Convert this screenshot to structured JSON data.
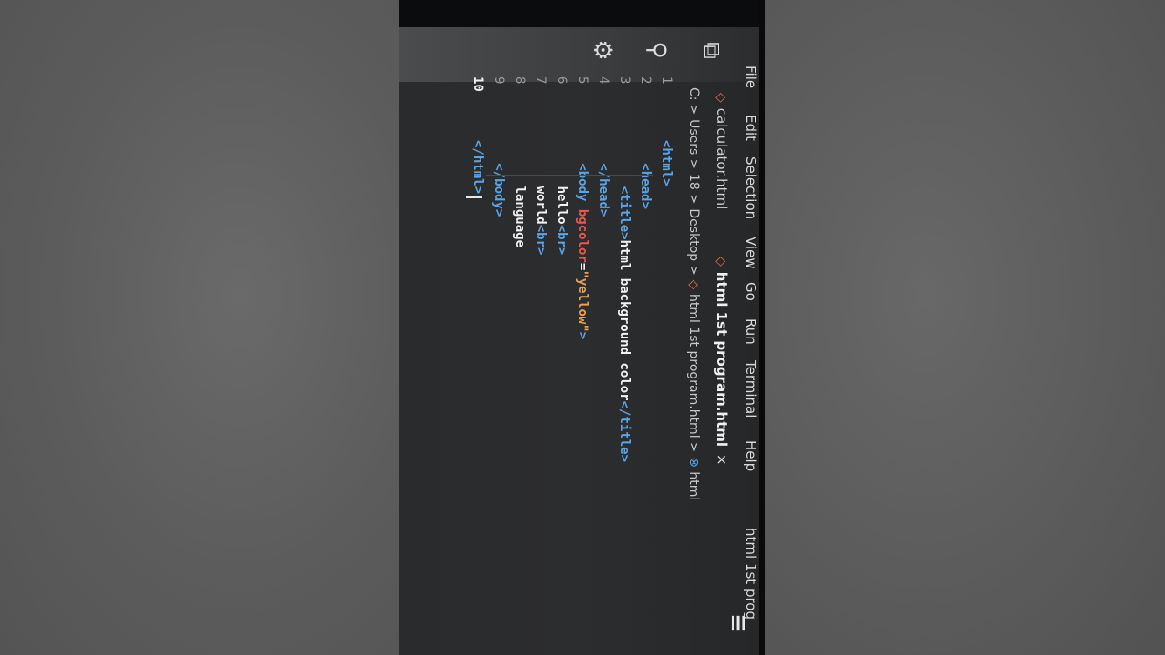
{
  "menu": [
    "File",
    "Edit",
    "Selection",
    "View",
    "Go",
    "Run",
    "Terminal",
    "Help"
  ],
  "window_title": "html 1st prog",
  "tabs": [
    {
      "label": "calculator.html",
      "active": false
    },
    {
      "label": "html 1st program.html",
      "active": true
    }
  ],
  "tab_close": "×",
  "breadcrumb": "C: > Users > 18 > Desktop > ",
  "breadcrumb_file": "html 1st program.html > ",
  "breadcrumb_symbol": "html",
  "line_numbers": [
    "1",
    "2",
    "3",
    "4",
    "5",
    "6",
    "7",
    "8",
    "9",
    "10"
  ],
  "code": {
    "l1": "<html>",
    "l2": "<head>",
    "l3_open": "<title>",
    "l3_text": "html background color",
    "l3_close": "</title>",
    "l4": "</head>",
    "l5_open": "<body ",
    "l5_attr": "bgcolor",
    "l5_eq": "=",
    "l5_val": "\"yellow\"",
    "l5_close": ">",
    "l6_text": "hello",
    "l6_tag": "<br>",
    "l7_text": "world",
    "l7_tag": "<br>",
    "l8_text": "language",
    "l9": "</body>",
    "l10": "</html>"
  },
  "colors": {
    "tag": "#5ba4e6",
    "attr": "#e8584c",
    "string": "#e6a25a",
    "file_icon": "#e36b4f"
  }
}
